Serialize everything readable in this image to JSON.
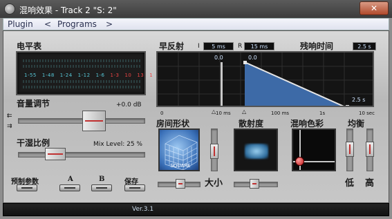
{
  "window": {
    "title": "混响效果 - Track 2  \"S: 2\"",
    "close_label": "✕"
  },
  "menu": {
    "plugin": "Plugin",
    "plugin_arrow": "<",
    "programs": "Programs",
    "programs_arrow": ">"
  },
  "meter": {
    "label": "电平表",
    "scale": [
      "1-55",
      "1-48",
      "1-24",
      "1-12",
      "1-6",
      "1-3",
      "10",
      "13",
      "1"
    ]
  },
  "volume": {
    "label": "音量调节",
    "value": "+0.0 dB",
    "level": 0.62
  },
  "mix": {
    "label": "干湿比例",
    "value": "Mix Level:  25 %",
    "level": 0.25
  },
  "presets": {
    "preset_label": "预制参数",
    "a_label": "A",
    "b_label": "B",
    "save_label": "保存"
  },
  "early": {
    "label": "早反射",
    "i_label": "I",
    "i_value": "5 ms",
    "r_label": "R",
    "r_value": "15 ms"
  },
  "tail": {
    "label": "残响时间",
    "value": "2.5 s"
  },
  "graph": {
    "early_marker": "0.0",
    "reverb_marker": "0.0",
    "decay_label": "2.5 s",
    "ticks": [
      "0",
      "10 ms",
      "100 ms",
      "1s",
      "10 sec"
    ]
  },
  "room": {
    "label": "房间形状",
    "shape": "SQUARE",
    "size_label": "大小",
    "size_level": 0.55
  },
  "diffusion": {
    "label": "散射度",
    "level": 0.45
  },
  "color": {
    "label": "混响色彩"
  },
  "balance": {
    "label": "均衡",
    "low_label": "低",
    "high_label": "高"
  },
  "status": {
    "version": "Ver.3.1"
  },
  "colors": {
    "accent": "#3d6aa7",
    "meter_text": "#57c8d8",
    "close": "#b04a2c"
  }
}
